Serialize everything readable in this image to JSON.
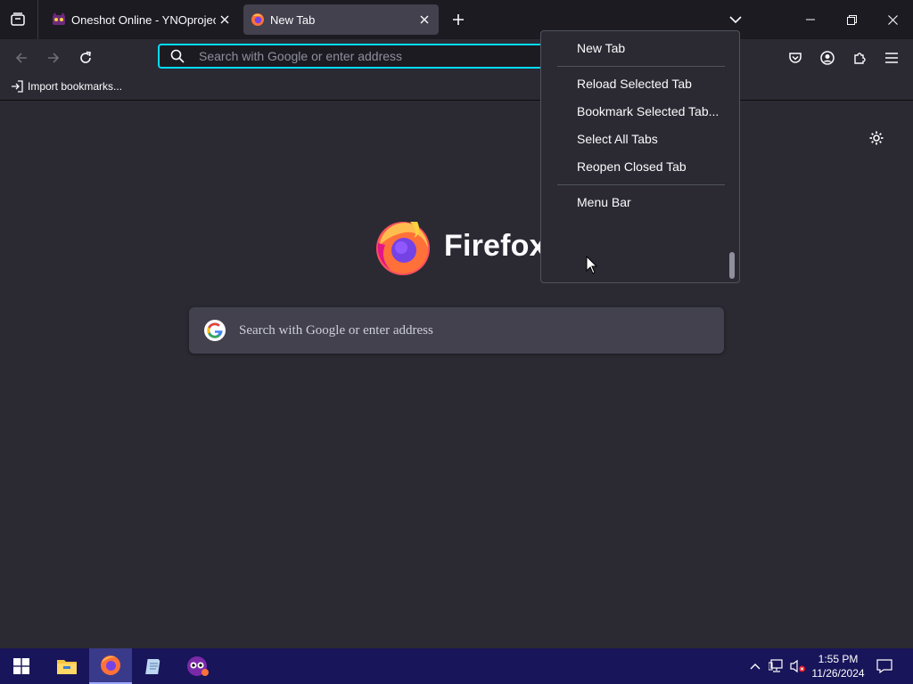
{
  "tabs": [
    {
      "title": "Oneshot Online - YNOproject",
      "favicon": "ynoproject-favicon"
    },
    {
      "title": "New Tab",
      "favicon": "firefox-favicon"
    }
  ],
  "urlbar": {
    "placeholder": "Search with Google or enter address"
  },
  "bookmarks_toolbar": {
    "import_label": "Import bookmarks..."
  },
  "new_tab_page": {
    "brand": "Firefox",
    "search_placeholder": "Search with Google or enter address"
  },
  "context_menu": {
    "items": [
      "New Tab",
      "Reload Selected Tab",
      "Bookmark Selected Tab...",
      "Select All Tabs",
      "Reopen Closed Tab",
      "Menu Bar"
    ]
  },
  "taskbar": {
    "time": "1:55 PM",
    "date": "11/26/2024",
    "apps": [
      "windows-start-icon",
      "file-explorer-icon",
      "firefox-icon",
      "notepad-icon",
      "ynoproject-icon"
    ]
  },
  "colors": {
    "accent": "#00ddff",
    "toolbar": "#2b2a33",
    "tabbar": "#1c1b22",
    "taskbar": "#18155a"
  }
}
